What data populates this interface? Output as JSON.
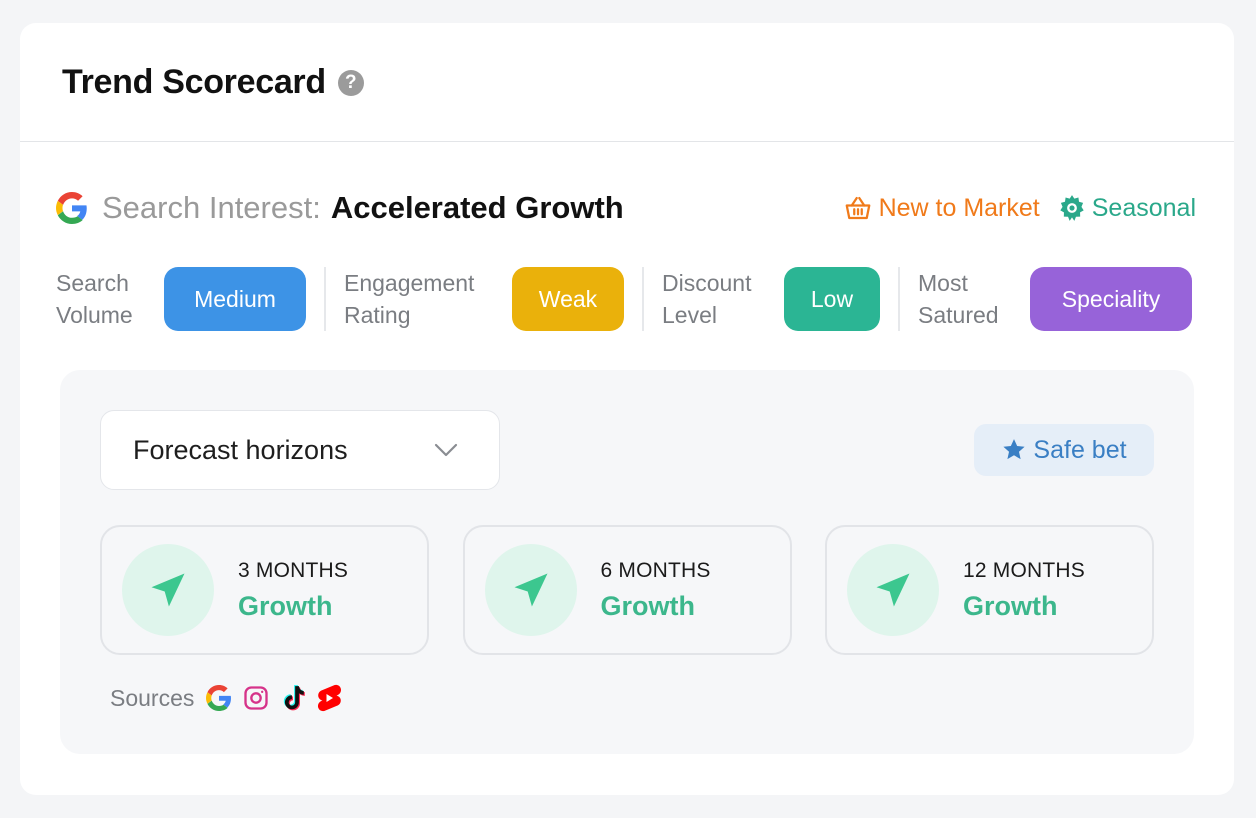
{
  "header": {
    "title": "Trend Scorecard",
    "help_glyph": "?"
  },
  "interest": {
    "label": "Search Interest:",
    "value": "Accelerated Growth",
    "icon": "google-icon"
  },
  "tags": [
    {
      "label": "New to Market",
      "icon": "basket-icon",
      "color": "#f07a1a"
    },
    {
      "label": "Seasonal",
      "icon": "gear-icon",
      "color": "#2aa88a"
    }
  ],
  "metrics": [
    {
      "label_line1": "Search",
      "label_line2": "Volume",
      "value": "Medium",
      "color": "#3d93e6"
    },
    {
      "label_line1": "Engagement",
      "label_line2": "Rating",
      "value": "Weak",
      "color": "#eab10b"
    },
    {
      "label_line1": "Discount",
      "label_line2": "Level",
      "value": "Low",
      "color": "#2bb594"
    },
    {
      "label_line1": "Most",
      "label_line2": "Satured",
      "value": "Speciality",
      "color": "#9763d9"
    }
  ],
  "forecast": {
    "dropdown_label": "Forecast horizons",
    "badge_label": "Safe bet",
    "horizons": [
      {
        "period": "3 MONTHS",
        "trend": "Growth"
      },
      {
        "period": "6 MONTHS",
        "trend": "Growth"
      },
      {
        "period": "12 MONTHS",
        "trend": "Growth"
      }
    ],
    "sources_label": "Sources",
    "sources": [
      "google-icon",
      "instagram-icon",
      "tiktok-icon",
      "youtube-shorts-icon"
    ]
  },
  "colors": {
    "accent_green": "#3cb78c",
    "badge_blue": "#3a7fc4"
  }
}
